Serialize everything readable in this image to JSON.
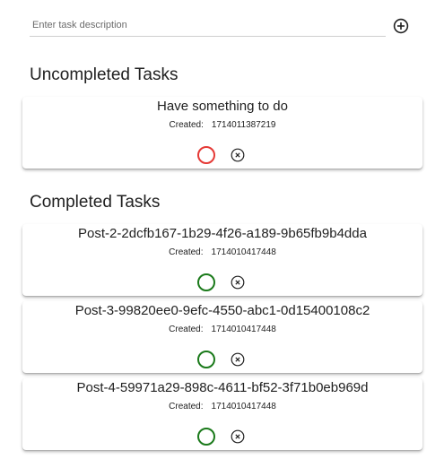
{
  "input": {
    "placeholder": "Enter task description",
    "value": ""
  },
  "add_button_icon": "add-circle-icon",
  "sections": {
    "uncompleted": {
      "heading": "Uncompleted Tasks",
      "tasks": [
        {
          "title": "Have something to do",
          "created_label": "Created:",
          "created_value": "1714011387219",
          "status": "uncompleted"
        }
      ]
    },
    "completed": {
      "heading": "Completed Tasks",
      "tasks": [
        {
          "title": "Post-2-2dcfb167-1b29-4f26-a189-9b65fb9b4dda",
          "created_label": "Created:",
          "created_value": "1714010417448",
          "status": "completed"
        },
        {
          "title": "Post-3-99820ee0-9efc-4550-abc1-0d15400108c2",
          "created_label": "Created:",
          "created_value": "1714010417448",
          "status": "completed"
        },
        {
          "title": "Post-4-59971a29-898c-4611-bf52-3f71b0eb969d",
          "created_label": "Created:",
          "created_value": "1714010417448",
          "status": "completed"
        }
      ]
    }
  },
  "colors": {
    "uncompleted_ring": "#e53935",
    "completed_ring": "#1b7a1b",
    "icon": "#212121"
  }
}
